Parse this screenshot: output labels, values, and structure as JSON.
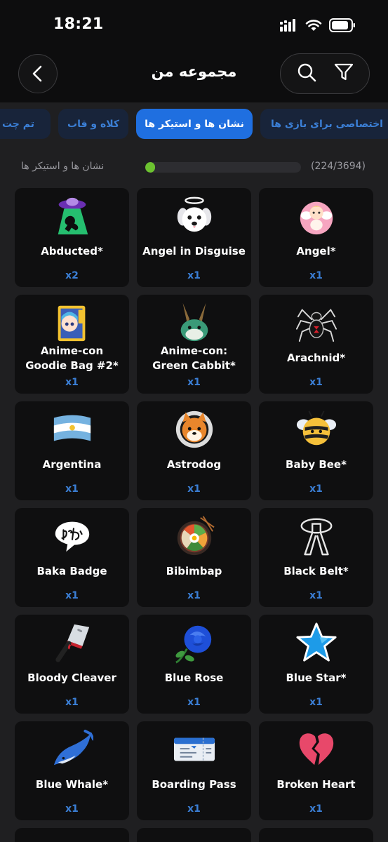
{
  "status": {
    "time": "18:21"
  },
  "header": {
    "title": "مجموعه من"
  },
  "tabs": [
    {
      "label": "اختصاصی برای بازی ها",
      "active": false
    },
    {
      "label": "نشان ها و استیکر ها",
      "active": true
    },
    {
      "label": "کلاه و قاب",
      "active": false
    },
    {
      "label": "تم چت",
      "active": false
    }
  ],
  "progress": {
    "label": "نشان ها و استیکر ها",
    "count": "(224/3694)",
    "fraction": 0.0606
  },
  "items": [
    {
      "name": "Abducted*",
      "count": "x2",
      "icon": "ufo-icon"
    },
    {
      "name": "Angel in Disguise",
      "count": "x1",
      "icon": "angel-dog-icon"
    },
    {
      "name": "Angel*",
      "count": "x1",
      "icon": "cherub-icon"
    },
    {
      "name": "Anime-con Goodie Bag #2*",
      "count": "x1",
      "icon": "goodie-bag-icon"
    },
    {
      "name": "Anime-con: Green Cabbit*",
      "count": "x1",
      "icon": "green-cabbit-icon"
    },
    {
      "name": "Arachnid*",
      "count": "x1",
      "icon": "spider-icon"
    },
    {
      "name": "Argentina",
      "count": "x1",
      "icon": "argentina-flag-icon"
    },
    {
      "name": "Astrodog",
      "count": "x1",
      "icon": "astrodog-icon"
    },
    {
      "name": "Baby Bee*",
      "count": "x1",
      "icon": "bee-icon"
    },
    {
      "name": "Baka Badge",
      "count": "x1",
      "icon": "baka-speech-bubble-icon"
    },
    {
      "name": "Bibimbap",
      "count": "x1",
      "icon": "bibimbap-bowl-icon"
    },
    {
      "name": "Black Belt*",
      "count": "x1",
      "icon": "black-belt-icon"
    },
    {
      "name": "Bloody Cleaver",
      "count": "x1",
      "icon": "cleaver-icon"
    },
    {
      "name": "Blue Rose",
      "count": "x1",
      "icon": "blue-rose-icon"
    },
    {
      "name": "Blue Star*",
      "count": "x1",
      "icon": "blue-star-icon"
    },
    {
      "name": "Blue Whale*",
      "count": "x1",
      "icon": "blue-whale-icon"
    },
    {
      "name": "Boarding Pass",
      "count": "x1",
      "icon": "boarding-pass-icon"
    },
    {
      "name": "Broken Heart",
      "count": "x1",
      "icon": "broken-heart-icon"
    }
  ],
  "colors": {
    "accent": "#1f6fe0",
    "count": "#3b7fd6",
    "progress": "#6cc230",
    "card": "#0f0f10",
    "background": "#1f1f21"
  }
}
